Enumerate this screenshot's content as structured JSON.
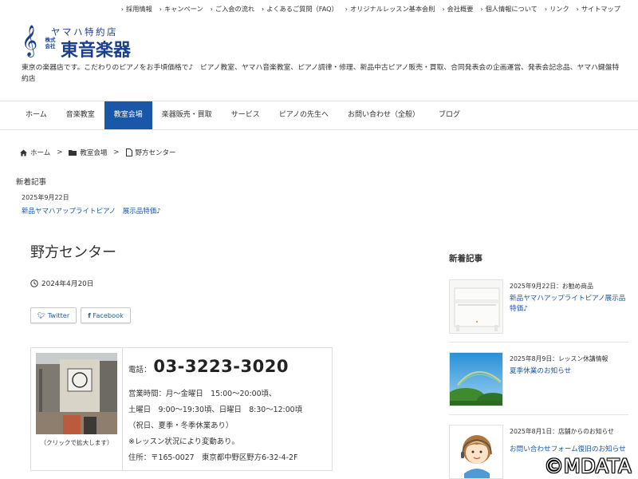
{
  "topnav": [
    "採用情報",
    "キャンペーン",
    "ご入会の流れ",
    "よくあるご質問（FAQ）",
    "オリジナルレッスン基本会則",
    "会社概要",
    "個人情報について",
    "リンク",
    "サイトマップ"
  ],
  "logo": {
    "tagline": "ヤマハ特約店",
    "corp": "株式会社",
    "name": "東音楽器"
  },
  "description": "東京の楽器店です。こだわりのピアノをお手頃価格で♪　ピアノ教室、ヤマハ音楽教室、ピアノ調律・修理、新品中古ピアノ販売・買取、合同発表会の企画運営、発表会記念品、ヤマハ鍵盤特約店",
  "mainnav": [
    {
      "label": "ホーム",
      "active": false
    },
    {
      "label": "音楽教室",
      "active": false
    },
    {
      "label": "教室会場",
      "active": true
    },
    {
      "label": "楽器販売・買取",
      "active": false
    },
    {
      "label": "サービス",
      "active": false
    },
    {
      "label": "ピアノの先生へ",
      "active": false
    },
    {
      "label": "お問い合わせ（全般）",
      "active": false
    },
    {
      "label": "ブログ",
      "active": false
    }
  ],
  "breadcrumb": {
    "home": "ホーム",
    "category": "教室会場",
    "current": "野方センター"
  },
  "news": {
    "heading": "新着記事",
    "date": "2025年9月22日",
    "link": "新品ヤマハアップライトピアノ　展示品特価♪"
  },
  "article": {
    "title": "野方センター",
    "date": "2024年4月20日",
    "share_twitter": "Twitter",
    "share_facebook": "Facebook",
    "photo_caption": "（クリックで拡大します）",
    "tel_label": "電話：",
    "tel_number": "03-3223-3020",
    "lines": [
      "営業時間：月～金曜日　15:00～20:00頃、",
      "土曜日　9:00～19:30頃、日曜日　8:30～12:00頃",
      "（祝日、夏季・冬季休業あり）",
      "※レッスン状況により変動あり。",
      "住所：〒165-0027　東京都中野区野方6-32-4-2F"
    ]
  },
  "sidebar": {
    "heading": "新着記事",
    "items": [
      {
        "meta": "2025年9月22日：お勧め商品",
        "link": "新品ヤマハアップライトピアノ展示品特価♪"
      },
      {
        "meta": "2025年8月9日：レッスン休講情報",
        "link": "夏季休業のお知らせ"
      },
      {
        "meta": "2025年8月1日：店舗からのお知らせ",
        "link": "お問い合わせフォーム復旧のお知らせ"
      }
    ]
  },
  "watermark": "©MDATA",
  "colors": {
    "accent": "#1a57a8",
    "brand": "#1a3f8f"
  }
}
